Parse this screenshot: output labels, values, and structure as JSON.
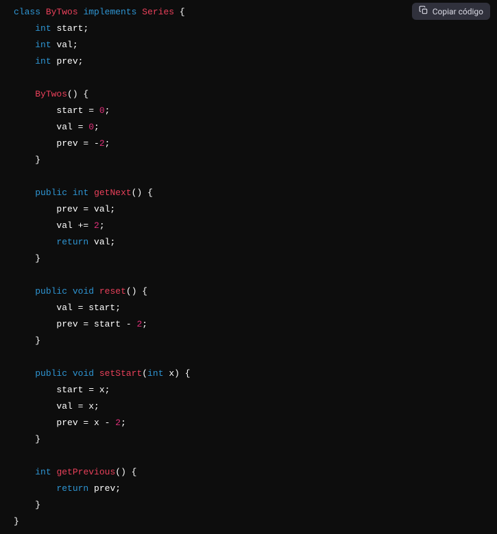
{
  "copy_button": {
    "label": "Copiar código"
  },
  "code": {
    "tokens": {
      "kw_class": "class",
      "cls_ByTwos": "ByTwos",
      "kw_implements": "implements",
      "cls_Series": "Series",
      "type_int": "int",
      "id_start": "start",
      "id_val": "val",
      "id_prev": "prev",
      "ctor_ByTwos": "ByTwos",
      "num_0a": "0",
      "num_0b": "0",
      "num_neg2": "2",
      "kw_public": "public",
      "fn_getNext": "getNext",
      "num_2a": "2",
      "kw_return": "return",
      "type_void": "void",
      "fn_reset": "reset",
      "num_2b": "2",
      "fn_setStart": "setStart",
      "id_x": "x",
      "num_2c": "2",
      "fn_getPrevious": "getPrevious"
    }
  }
}
